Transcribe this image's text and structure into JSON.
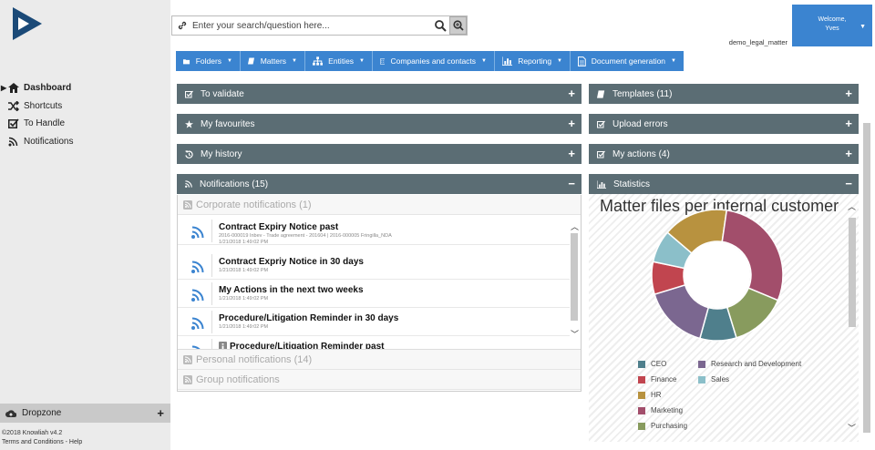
{
  "sidebar": {
    "items": [
      {
        "label": "Dashboard",
        "icon": "home-icon",
        "active": true
      },
      {
        "label": "Shortcuts",
        "icon": "shuffle-icon",
        "active": false
      },
      {
        "label": "To Handle",
        "icon": "checkbox-icon",
        "active": false
      },
      {
        "label": "Notifications",
        "icon": "rss-icon",
        "active": false
      }
    ],
    "dropzone_label": "Dropzone",
    "dropzone_toggle": "+",
    "footer_line1": "©2018 Knowliah v4.2",
    "footer_line2": "Terms and Conditions - Help"
  },
  "search": {
    "placeholder": "Enter your search/question here..."
  },
  "user": {
    "welcome": "Welcome,",
    "name": "Yves",
    "matter": "demo_legal_matter"
  },
  "toolbar": {
    "items": [
      "Folders",
      "Matters",
      "Entities",
      "Companies and contacts",
      "Reporting",
      "Document generation"
    ]
  },
  "panels": {
    "to_validate": {
      "label": "To validate",
      "toggle": "+"
    },
    "favourites": {
      "label": "My favourites",
      "toggle": "+"
    },
    "history": {
      "label": "My history",
      "toggle": "+"
    },
    "notifications": {
      "label": "Notifications (15)",
      "toggle": "−"
    },
    "templates": {
      "label": "Templates (11)",
      "toggle": "+"
    },
    "upload_errors": {
      "label": "Upload errors",
      "toggle": "+"
    },
    "actions": {
      "label": "My actions (4)",
      "toggle": "+"
    },
    "statistics": {
      "label": "Statistics",
      "toggle": "−"
    }
  },
  "notification_groups": {
    "corporate": "Corporate notifications (1)",
    "personal": "Personal notifications (14)",
    "group": "Group notifications"
  },
  "notifications": [
    {
      "title": "Contract Expiry Notice past",
      "line1": "2016-000019 Inbev - Trade agreement - 201604 | 2016-000005 Fringilla_NDA",
      "line2": "1/21/2018 1:49:02 PM"
    },
    {
      "title": "Contract Expriy Notice in 30 days",
      "line1": "1/21/2018 1:49:02 PM",
      "line2": ""
    },
    {
      "title": "My Actions in the next two weeks",
      "line1": "1/21/2018 1:49:02 PM",
      "line2": ""
    },
    {
      "title": "Procedure/Litigation Reminder in 30 days",
      "line1": "1/21/2018 1:49:02 PM",
      "line2": ""
    },
    {
      "title": "Procedure/Litigation Reminder past",
      "line1": "",
      "line2": ""
    }
  ],
  "colors": {
    "accent": "#3b84d0",
    "panel_header": "#5b6d74",
    "sidebar": "#ebebeb"
  },
  "chart_data": {
    "type": "pie",
    "title": "Matter files per internal customer",
    "categories": [
      "CEO",
      "Research and Development",
      "Finance",
      "Sales",
      "HR",
      "Marketing",
      "Purchasing"
    ],
    "values": [
      9,
      16,
      8,
      8,
      16,
      29,
      14
    ],
    "colors": [
      "#4f7f8c",
      "#7b6790",
      "#c1454f",
      "#8bbfc9",
      "#b8923f",
      "#a24e6b",
      "#889b5e"
    ],
    "donut": true
  }
}
